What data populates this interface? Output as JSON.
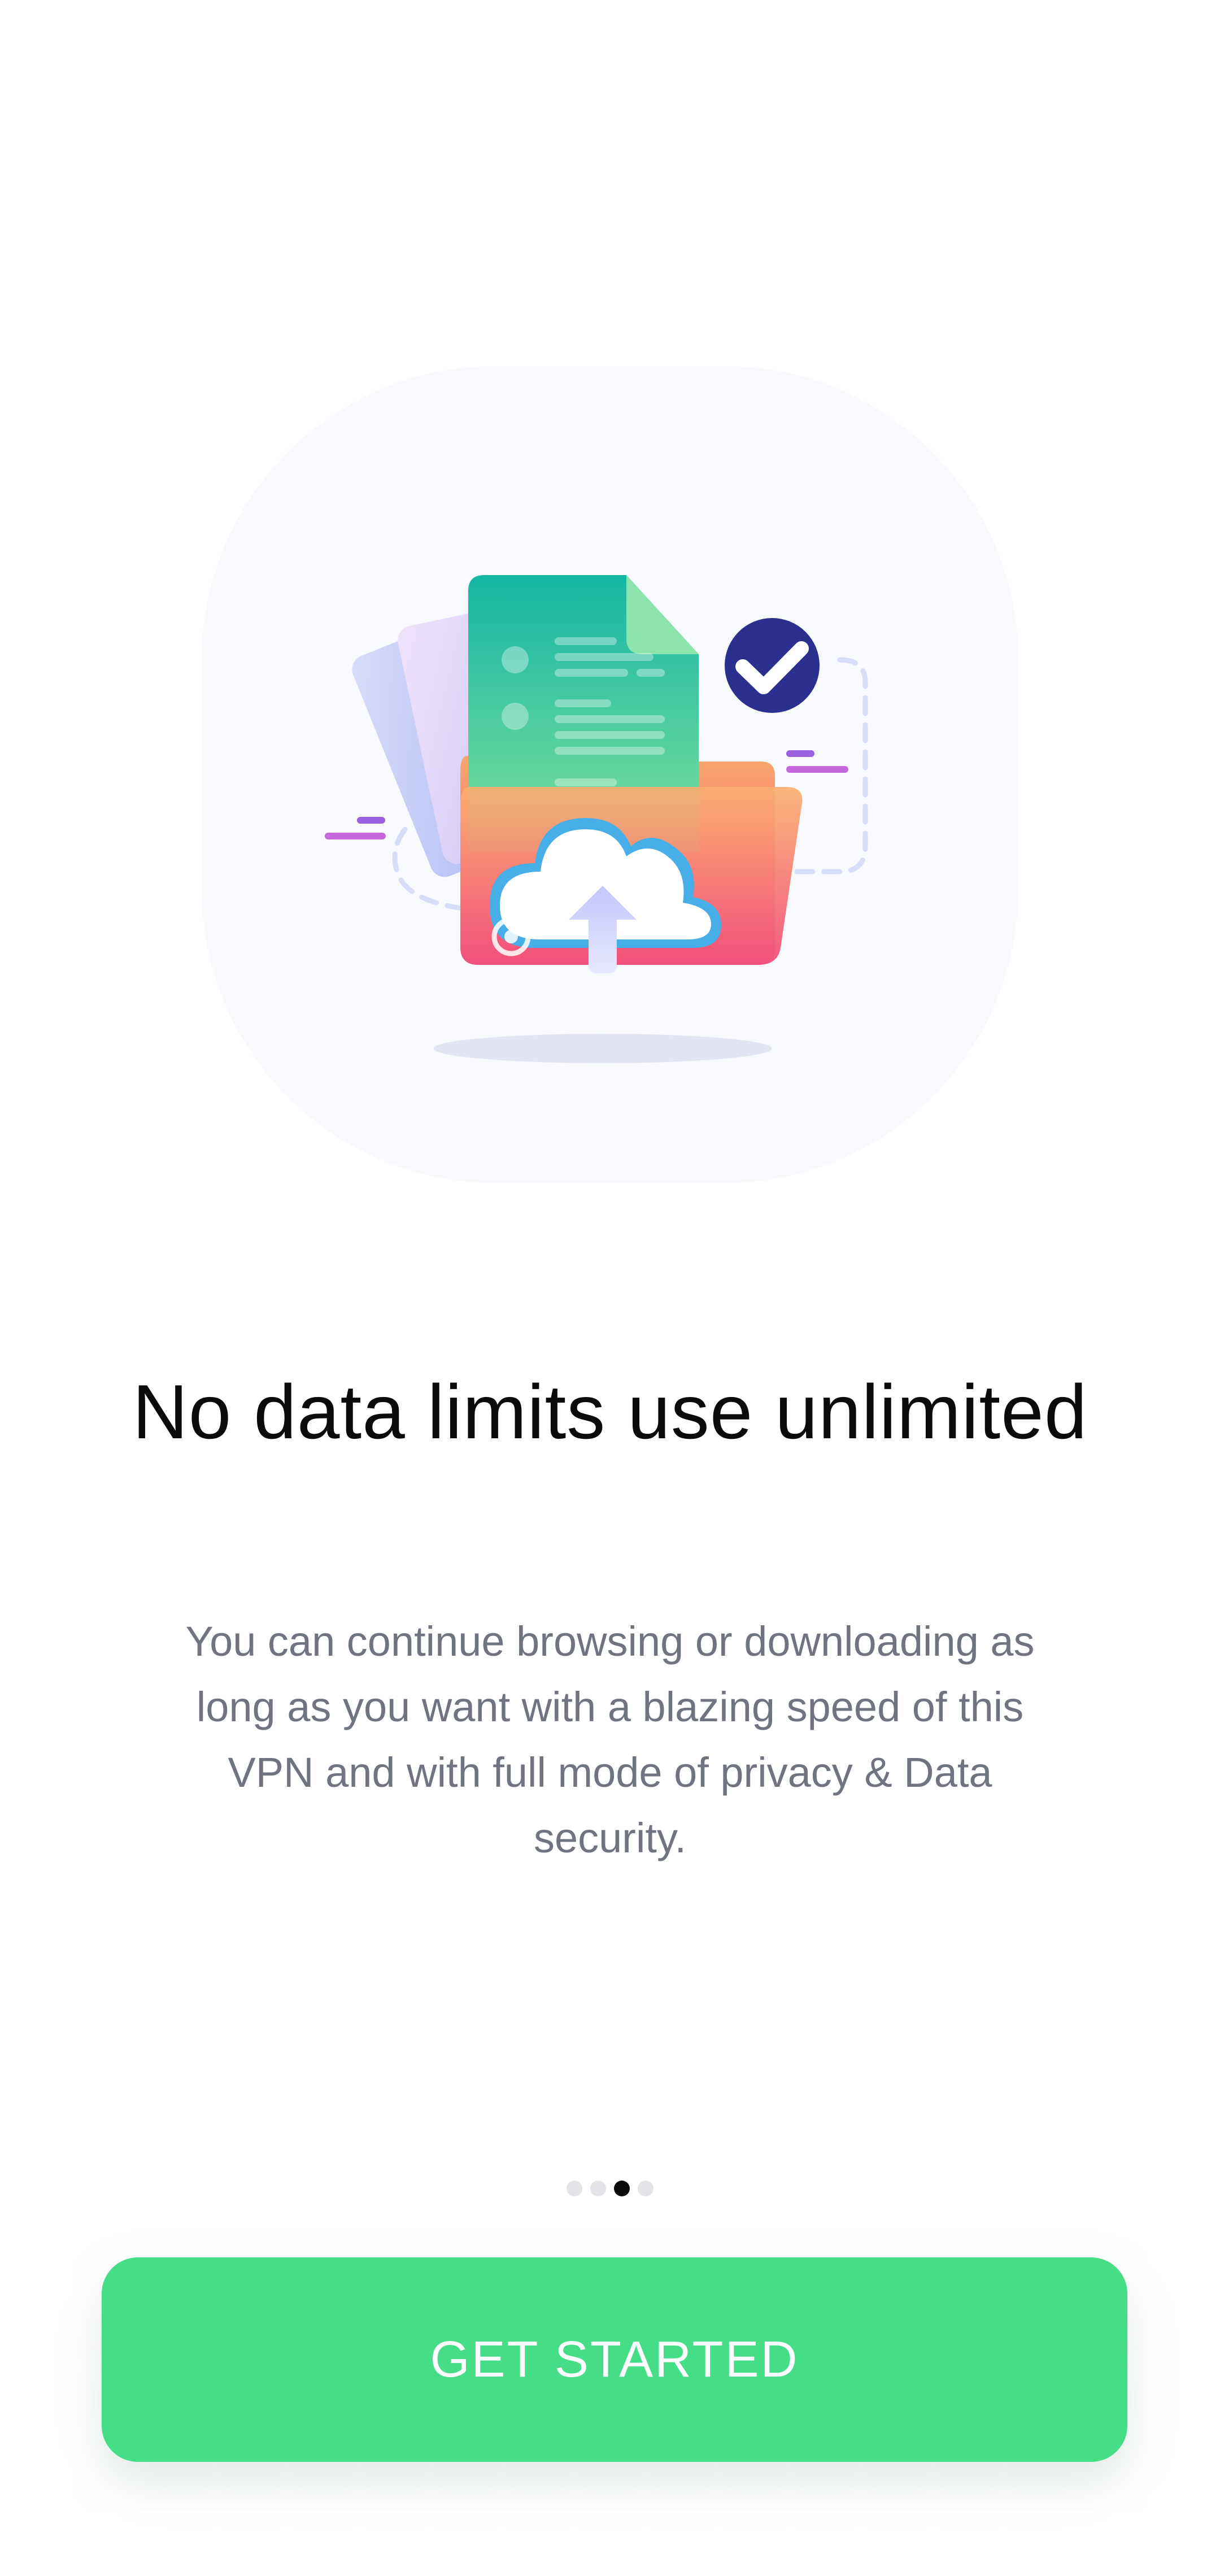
{
  "onboarding": {
    "illustration": {
      "icons": [
        "folder-icon",
        "document-icon",
        "cloud-upload-icon",
        "checkmark-icon"
      ],
      "colors": {
        "background": "#f8f9fd",
        "document": "#2cc59e",
        "folder_top": "#f7a860",
        "folder_bottom": "#f04c7a",
        "check": "#2b2f8e",
        "accent": "#c566dd"
      }
    },
    "title": "No data limits use unlimited",
    "description": "You can continue browsing or downloading as long as you want with a blazing speed of this VPN and with full mode of privacy & Data security.",
    "pager": {
      "total": 4,
      "current": 3
    },
    "cta_label": "GET STARTED",
    "colors": {
      "cta": "#46dd87",
      "title": "#0b0b0b",
      "description": "#6f7480"
    }
  }
}
